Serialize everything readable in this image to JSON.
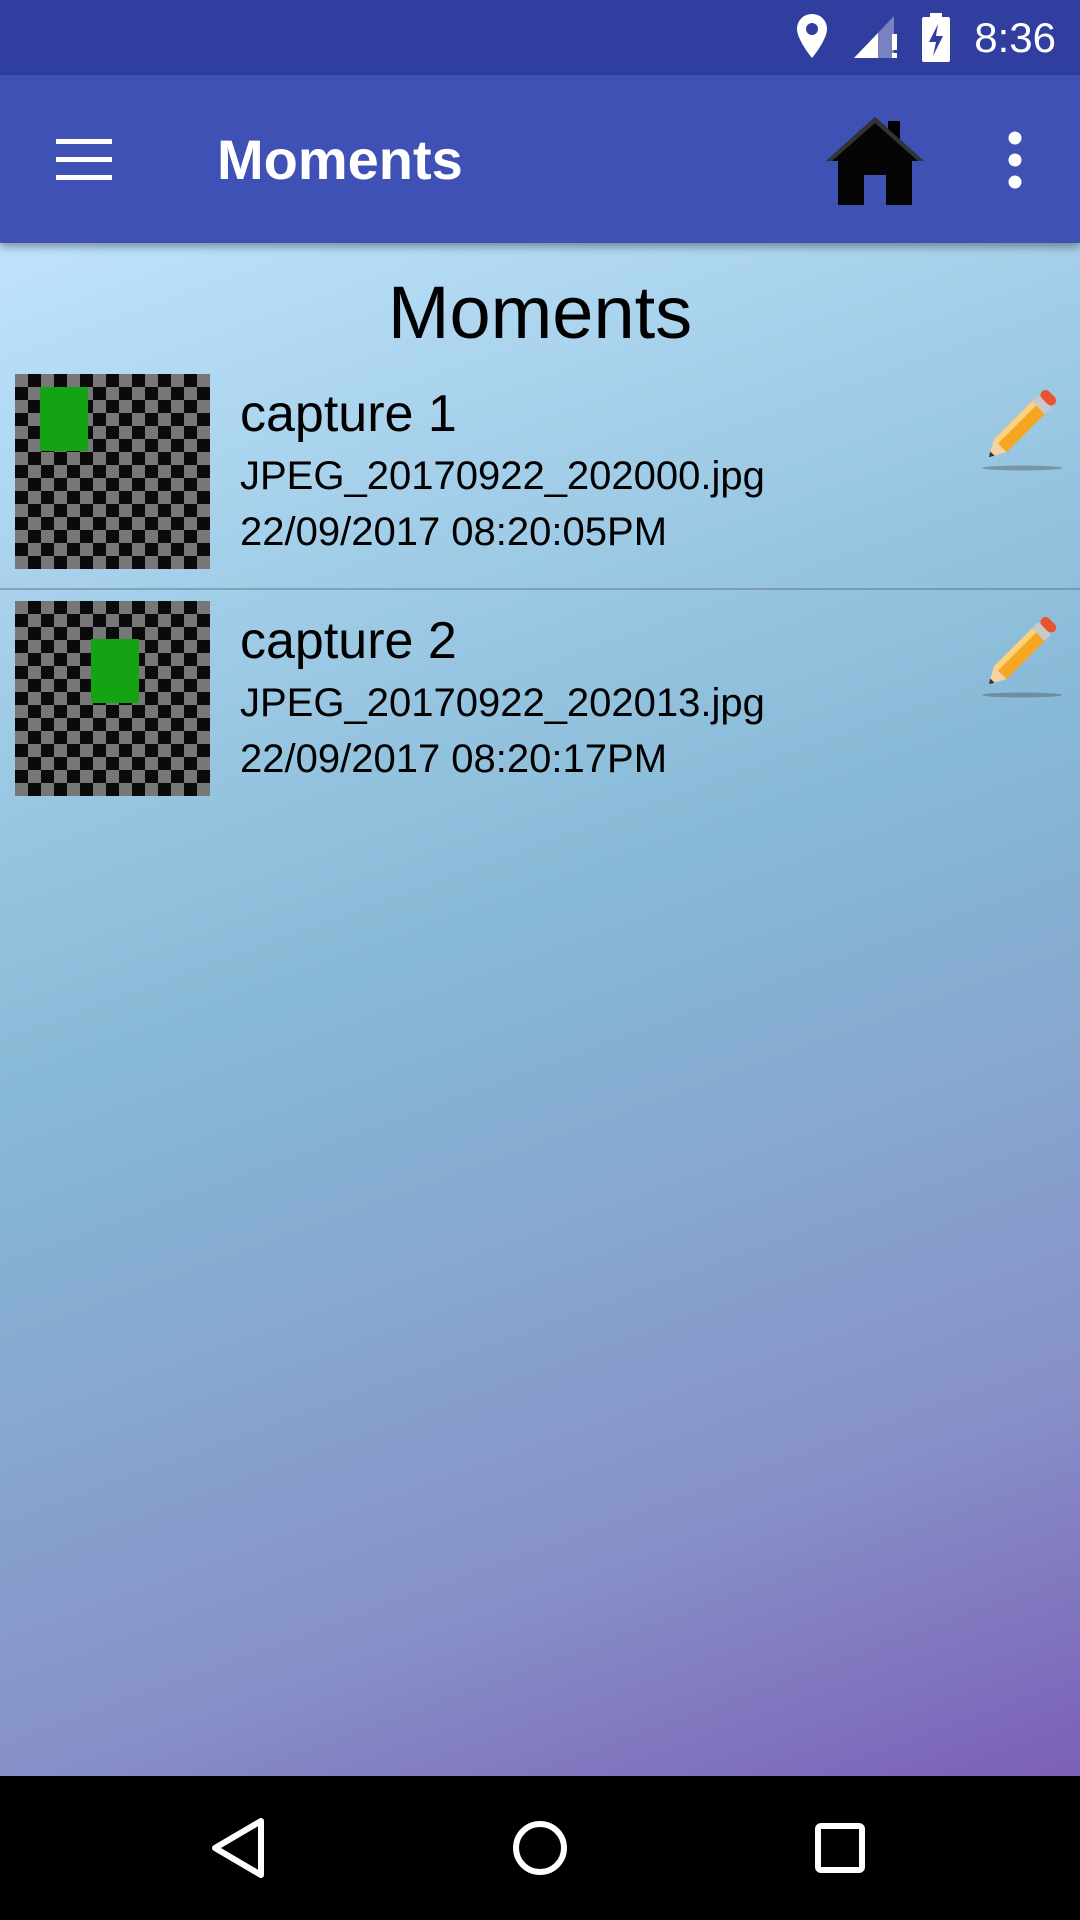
{
  "status_bar": {
    "time": "8:36",
    "icons": [
      "location-icon",
      "signal-icon",
      "battery-charging-icon"
    ]
  },
  "app_bar": {
    "title": "Moments",
    "color": "#3f51b5",
    "icons": [
      "menu-icon",
      "home-icon",
      "more-vert-icon"
    ]
  },
  "page": {
    "heading": "Moments"
  },
  "moments": [
    {
      "name": "capture 1",
      "file": "JPEG_20170922_202000.jpg",
      "datetime": "22/09/2017 08:20:05PM"
    },
    {
      "name": "capture 2",
      "file": "JPEG_20170922_202013.jpg",
      "datetime": "22/09/2017 08:20:17PM"
    }
  ],
  "nav_bar": {
    "icons": [
      "back-icon",
      "home-circle-icon",
      "recents-icon"
    ]
  }
}
